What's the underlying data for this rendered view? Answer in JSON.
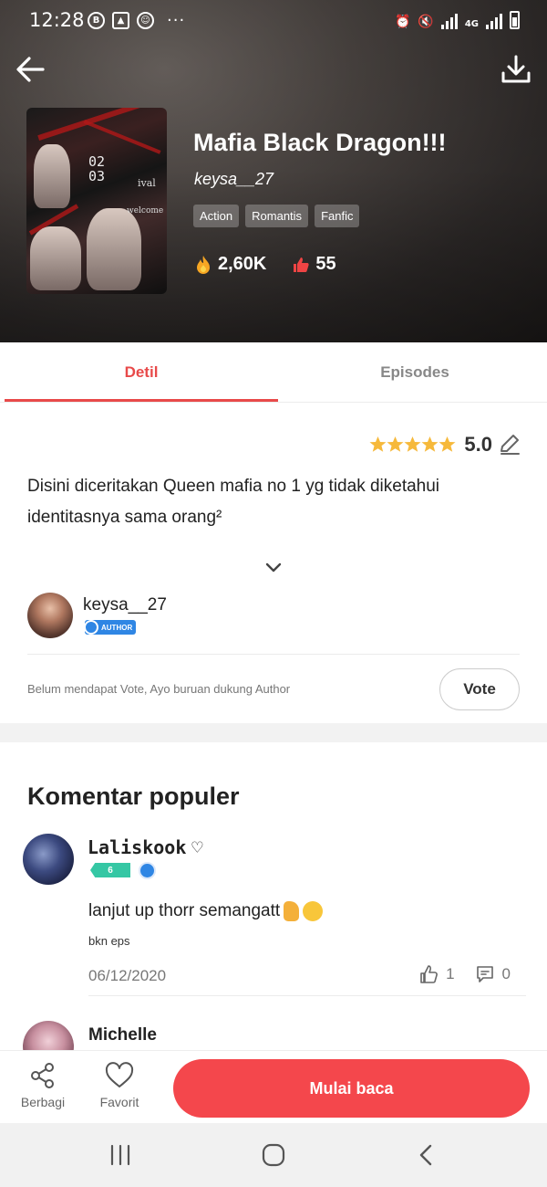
{
  "status_bar": {
    "time": "12:28",
    "left_icons": [
      "b-icon",
      "image-icon",
      "emoji-icon"
    ],
    "dots": "···",
    "network": "4G"
  },
  "header": {
    "title": "Mafia Black Dragon!!!",
    "author": "keysa__27",
    "tags": [
      "Action",
      "Romantis",
      "Fanfic"
    ],
    "views": "2,60K",
    "likes": "55",
    "cover_text": {
      "num1": "02",
      "num2": "03",
      "word1": "ival",
      "word2": "welcome"
    }
  },
  "tabs": {
    "detail": "Detil",
    "episodes": "Episodes"
  },
  "detail": {
    "rating": "5.0",
    "description": "Disini diceritakan Queen mafia no 1 yg tidak diketahui identitasnya sama orang²",
    "author_name": "keysa__27",
    "author_badge": "AUTHOR",
    "vote_text": "Belum mendapat Vote, Ayo buruan dukung Author",
    "vote_button": "Vote"
  },
  "comments": {
    "title": "Komentar populer",
    "items": [
      {
        "name": "Laliskook",
        "heart": "♡",
        "level": "6",
        "text": "lanjut up thorr semangatt",
        "sub": "bkn eps",
        "date": "06/12/2020",
        "likes": "1",
        "replies": "0"
      },
      {
        "name": "Michelle"
      }
    ]
  },
  "action_bar": {
    "share": "Berbagi",
    "favorite": "Favorit",
    "read": "Mulai baca"
  },
  "colors": {
    "accent": "#f4474c",
    "tab_active": "#e84a4a",
    "star": "#f6b93b",
    "badge_blue": "#2f86e4",
    "level_green": "#35c7a4"
  }
}
